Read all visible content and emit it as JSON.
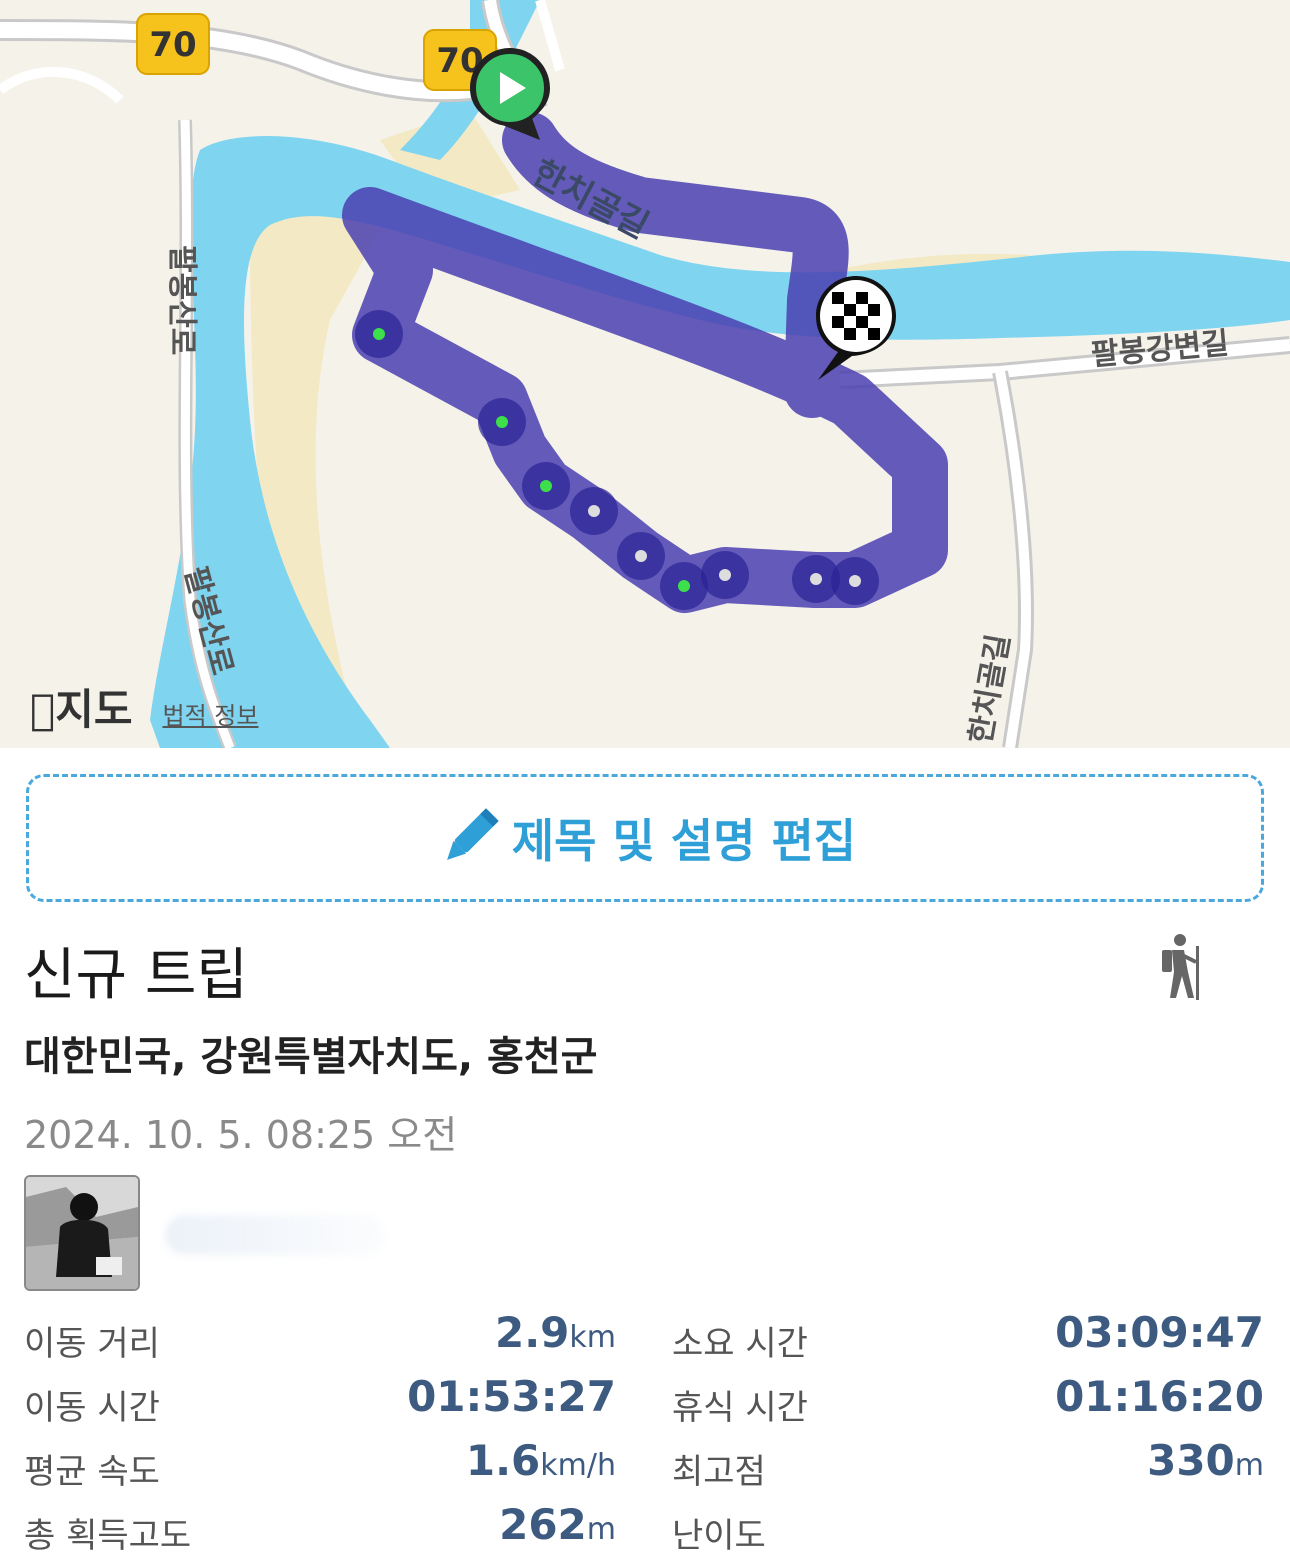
{
  "map": {
    "shields": [
      "70",
      "70"
    ],
    "road_labels": {
      "hanchigol_top": "한치골길",
      "palbong_river": "팔봉강변길",
      "palbongsan_left_upper": "팔봉산로",
      "palbongsan_left_lower": "팔봉산로",
      "hanchigol_bottom": "한치골길"
    },
    "attribution": {
      "logo": "지도",
      "legal": "법적 정보"
    },
    "colors": {
      "route": "#4a3fb0",
      "water": "#7fd4f0",
      "land": "#f5f2ea",
      "start": "#3cc46a"
    }
  },
  "edit": {
    "label": "제목 및 설명 편집",
    "icon": "pencil-icon"
  },
  "trip": {
    "title": "신규 트립",
    "location": "대한민국, 강원특별자치도, 홍천군",
    "datetime": "2024. 10. 5. 08:25 오전",
    "activity_icon": "hiker-icon"
  },
  "stats": {
    "distance": {
      "label": "이동 거리",
      "value": "2.9",
      "unit": "km"
    },
    "duration": {
      "label": "소요 시간",
      "value": "03:09:47",
      "unit": ""
    },
    "moving_time": {
      "label": "이동 시간",
      "value": "01:53:27",
      "unit": ""
    },
    "rest_time": {
      "label": "휴식 시간",
      "value": "01:16:20",
      "unit": ""
    },
    "avg_speed": {
      "label": "평균 속도",
      "value": "1.6",
      "unit": "km/h"
    },
    "max_altitude": {
      "label": "최고점",
      "value": "330",
      "unit": "m"
    },
    "elevation_gain": {
      "label": "총 획득고도",
      "value": "262",
      "unit": "m"
    },
    "difficulty": {
      "label": "난이도",
      "value": "",
      "unit": ""
    }
  }
}
